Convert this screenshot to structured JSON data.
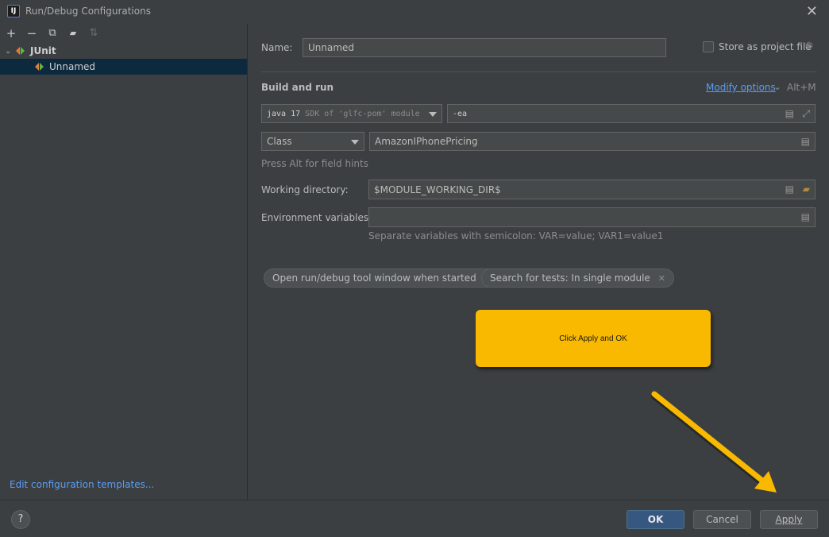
{
  "window": {
    "title": "Run/Debug Configurations",
    "app_icon": "IJ"
  },
  "left_toolbar": {
    "icons": [
      "add-icon",
      "remove-icon",
      "copy-icon",
      "folder-icon",
      "sort-icon"
    ],
    "glyphs": [
      "+",
      "−",
      "⧉",
      "▰",
      "⇅"
    ]
  },
  "tree": {
    "group_label": "JUnit",
    "item_label": "Unnamed"
  },
  "edit_templates_link": "Edit configuration templates...",
  "form": {
    "name_label": "Name:",
    "name_value": "Unnamed",
    "store_label": "Store as project file",
    "section_title": "Build and run",
    "modify_options": "Modify options",
    "modify_shortcut": "Alt+M",
    "jdk_value": "java 17",
    "jdk_suffix": "SDK of 'glfc-pom' module",
    "vm_options": "-ea",
    "test_kind": "Class",
    "class_value": "AmazonIPhonePricing",
    "field_hint": "Press Alt for field hints",
    "workdir_label": "Working directory:",
    "workdir_value": "$MODULE_WORKING_DIR$",
    "env_label": "Environment variables:",
    "env_value": "",
    "env_hint": "Separate variables with semicolon: VAR=value; VAR1=value1",
    "chips": [
      "Open run/debug tool window when started",
      "Search for tests: In single module"
    ]
  },
  "callout": {
    "text": "Click Apply and OK",
    "color": "#f8b900"
  },
  "buttons": {
    "help": "?",
    "ok": "OK",
    "cancel": "Cancel",
    "apply": "Apply"
  },
  "colors": {
    "accent": "#589df6",
    "selection": "#0d293e",
    "primary_button": "#365880"
  }
}
